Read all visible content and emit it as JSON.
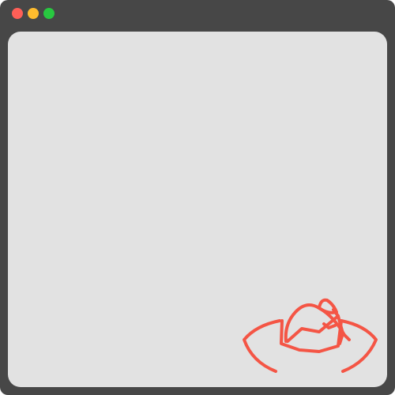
{
  "window": {
    "frame_color": "#474747",
    "content_background": "#e2e2e2",
    "traffic_lights": [
      {
        "name": "close",
        "color": "#ff5f57"
      },
      {
        "name": "minimize",
        "color": "#febc2e"
      },
      {
        "name": "maximize",
        "color": "#28c840"
      }
    ]
  },
  "content": {
    "logo": {
      "icon": "wizard-hat-icon",
      "color": "#f45545"
    }
  }
}
